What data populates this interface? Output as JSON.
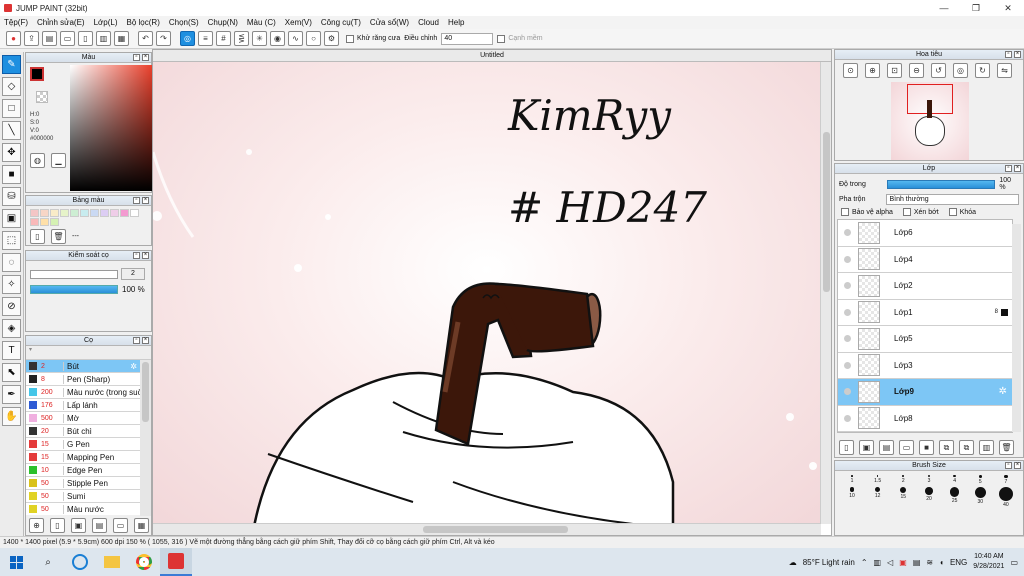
{
  "window": {
    "title": "JUMP PAINT (32bit)",
    "min": "—",
    "max": "❐",
    "close": "✕"
  },
  "menu": [
    "Tệp(F)",
    "Chỉnh sửa(E)",
    "Lớp(L)",
    "Bộ lọc(R)",
    "Chọn(S)",
    "Chụp(N)",
    "Màu (C)",
    "Xem(V)",
    "Công cụ(T)",
    "Cửa sổ(W)",
    "Cloud",
    "Help"
  ],
  "toolbar": {
    "antialias_label": "Khử răng cưa",
    "adjust_label": "Điều chỉnh",
    "adjust_value": "40",
    "edge_label": "Cạnh mềm"
  },
  "color_panel": {
    "title": "Màu",
    "hsv": [
      "H:0",
      "S:0",
      "V:0"
    ],
    "hex": "#000000"
  },
  "palette_panel": {
    "title": "Bảng màu",
    "swatches": [
      "#f4c6c6",
      "#f7d6c6",
      "#f9ecc8",
      "#e6f3c9",
      "#cdeed3",
      "#c8ecef",
      "#cad9f3",
      "#dccdf3",
      "#efcde8",
      "#f39ad0",
      "#ffffff",
      "#f9b9b9",
      "#ffe0a8",
      "#d5f1b3"
    ],
    "dash": "---"
  },
  "brush_control": {
    "title": "Kiểm soát cọ",
    "size": "2",
    "opacity": "100 %"
  },
  "brush_panel": {
    "title": "Cọ",
    "items": [
      {
        "size": "2",
        "name": "Bút",
        "color": "#333333",
        "selected": true
      },
      {
        "size": "8",
        "name": "Pen (Sharp)",
        "color": "#222222"
      },
      {
        "size": "200",
        "name": "Màu nước (trong suốt)",
        "color": "#45c6e8"
      },
      {
        "size": "176",
        "name": "Lấp lánh",
        "color": "#2e5bd4"
      },
      {
        "size": "500",
        "name": "Mờ",
        "color": "#f0b0e0"
      },
      {
        "size": "20",
        "name": "Bút chì",
        "color": "#333333"
      },
      {
        "size": "15",
        "name": "G Pen",
        "color": "#e43b3b"
      },
      {
        "size": "15",
        "name": "Mapping Pen",
        "color": "#e43b3b"
      },
      {
        "size": "10",
        "name": "Edge Pen",
        "color": "#2cc02c"
      },
      {
        "size": "50",
        "name": "Stipple Pen",
        "color": "#d9c21a"
      },
      {
        "size": "50",
        "name": "Sumi",
        "color": "#e0d224"
      },
      {
        "size": "50",
        "name": "Màu nước",
        "color": "#e0d224"
      }
    ]
  },
  "canvas": {
    "title": "Untitled",
    "handwriting_line1": "KimRyy",
    "handwriting_line2": "# HD247"
  },
  "navigator": {
    "title": "Hoa tiêu"
  },
  "layer_panel": {
    "title": "Lớp",
    "opacity_label": "Độ trong",
    "opacity_value": "100 %",
    "blend_label": "Pha trộn",
    "blend_value": "Bình thường",
    "protect_alpha": "Bảo vệ alpha",
    "clip": "Xén bớt",
    "lock": "Khóa",
    "layers": [
      {
        "name": "Lớp6"
      },
      {
        "name": "Lớp4"
      },
      {
        "name": "Lớp2"
      },
      {
        "name": "Lớp1",
        "badge": "8"
      },
      {
        "name": "Lớp5"
      },
      {
        "name": "Lớp3"
      },
      {
        "name": "Lớp9",
        "selected": true
      },
      {
        "name": "Lớp8"
      }
    ]
  },
  "brush_size_panel": {
    "title": "Brush Size",
    "row1": [
      "1",
      "1.5",
      "2",
      "3",
      "4",
      "5",
      "7"
    ],
    "row2": [
      "10",
      "12",
      "15",
      "20",
      "25",
      "30",
      "40"
    ]
  },
  "status": {
    "text": "1400 * 1400 pixel   (5.9 * 5.9cm)   600 dpi   150 %   ( 1055, 316 )   Vẽ một đường thẳng bằng cách giữ phím Shift, Thay đổi cỡ cọ bằng cách giữ phím Ctrl, Alt và kéo"
  },
  "taskbar": {
    "weather": "85°F  Light rain",
    "lang": "ENG",
    "time": "10:40 AM",
    "date": "9/28/2021"
  }
}
